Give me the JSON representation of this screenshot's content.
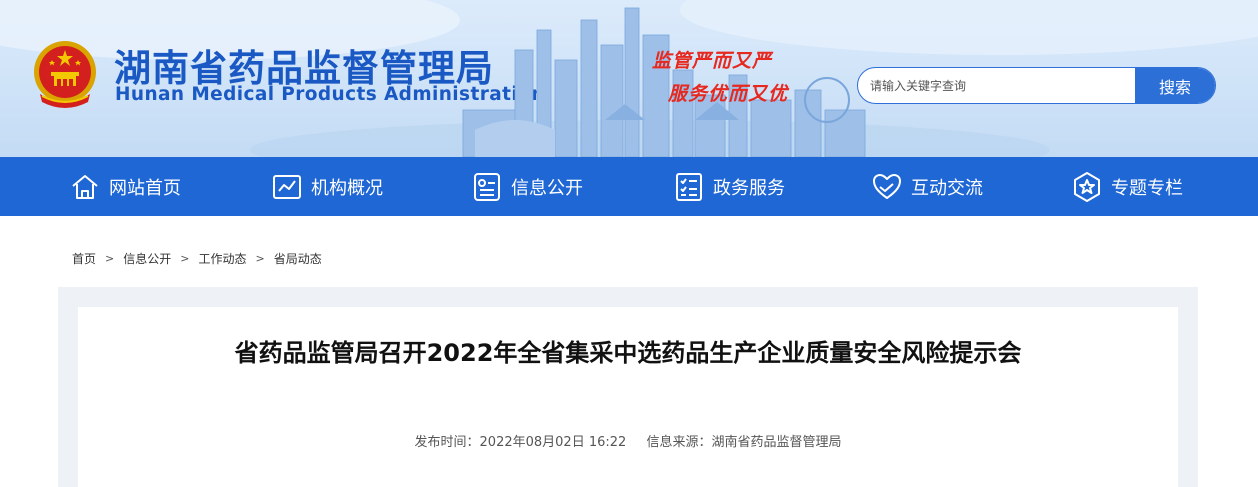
{
  "header": {
    "title": "湖南省药品监督管理局",
    "subtitle": "Hunan Medical Products Administration",
    "slogan_line1": "监管严而又严",
    "slogan_line2": "服务优而又优"
  },
  "search": {
    "placeholder": "请输入关键字查询",
    "value": "",
    "button_label": "搜索"
  },
  "nav": {
    "items": [
      {
        "label": "网站首页",
        "icon": "home-icon"
      },
      {
        "label": "机构概况",
        "icon": "chart-icon"
      },
      {
        "label": "信息公开",
        "icon": "info-card-icon"
      },
      {
        "label": "政务服务",
        "icon": "checklist-icon"
      },
      {
        "label": "互动交流",
        "icon": "heart-hands-icon"
      },
      {
        "label": "专题专栏",
        "icon": "star-badge-icon"
      }
    ]
  },
  "breadcrumb": {
    "items": [
      "首页",
      "信息公开",
      "工作动态",
      "省局动态"
    ],
    "separator": ">"
  },
  "article": {
    "title": "省药品监管局召开2022年全省集采中选药品生产企业质量安全风险提示会",
    "publish_time": "发布时间：2022年08月02日 16:22",
    "source": "信息来源：湖南省药品监督管理局"
  },
  "colors": {
    "brand_blue": "#1a58c4",
    "nav_blue": "#2067d6",
    "slogan_red": "#e6281f"
  }
}
